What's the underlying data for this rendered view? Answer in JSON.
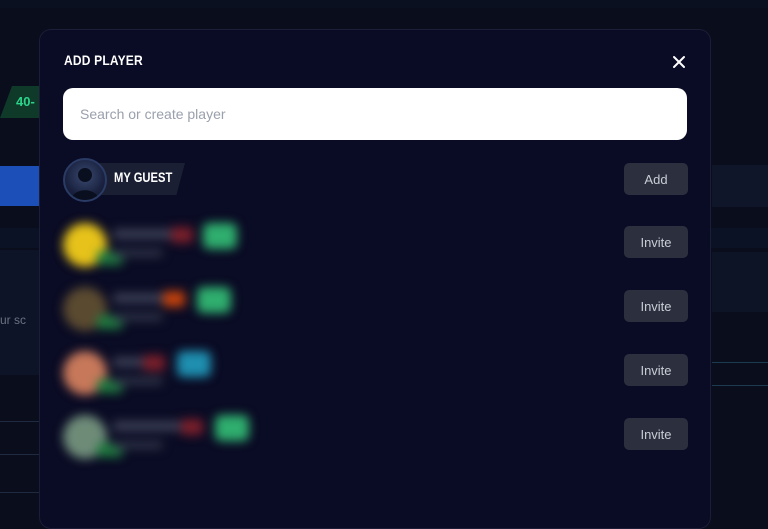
{
  "background": {
    "tag_text": "40-",
    "side_text": "ur sc"
  },
  "modal": {
    "title": "ADD PLAYER",
    "close_icon": "close-icon",
    "search": {
      "placeholder": "Search or create player",
      "value": ""
    },
    "guest": {
      "name": "MY GUEST",
      "action_label": "Add"
    },
    "players": [
      {
        "action_label": "Invite",
        "avatar_color": "#e6c21a",
        "badge_color": "#2fae6e",
        "flag_color": "#7a1f2a"
      },
      {
        "action_label": "Invite",
        "avatar_color": "#5a4a30",
        "badge_color": "#2fae6e",
        "flag_color": "#c2410c"
      },
      {
        "action_label": "Invite",
        "avatar_color": "#c7785a",
        "badge_color": "#1f8fb0",
        "flag_color": "#7a1f2a"
      },
      {
        "action_label": "Invite",
        "avatar_color": "#6e8b78",
        "badge_color": "#2fae6e",
        "flag_color": "#7a1f2a"
      }
    ]
  }
}
